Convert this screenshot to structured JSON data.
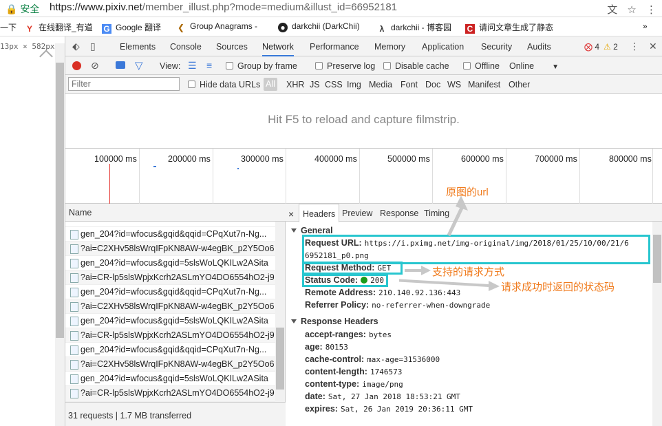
{
  "address_bar": {
    "secure_label": "安全",
    "url_main": "https://www.pixiv.net",
    "url_rest": "/member_illust.php?mode=medium&illust_id=66952181"
  },
  "bookmarks": [
    {
      "icon": "text-icon",
      "label": "一下"
    },
    {
      "icon": "youdao-icon",
      "label": "在线翻译_有道"
    },
    {
      "icon": "translate-icon",
      "label": "Google 翻译"
    },
    {
      "icon": "anagram-icon",
      "label": "Group Anagrams -"
    },
    {
      "icon": "github-icon",
      "label": "darkchii (DarkChii)"
    },
    {
      "icon": "cnblogs-icon",
      "label": "darkchii - 博客园"
    },
    {
      "icon": "csdn-icon",
      "label": "请问文章生成了静态"
    }
  ],
  "page_dims": "13px × 582px",
  "devtools": {
    "tabs": [
      "Elements",
      "Console",
      "Sources",
      "Network",
      "Performance",
      "Memory",
      "Application",
      "Security",
      "Audits"
    ],
    "active_tab": "Network",
    "error_count": "4",
    "warning_count": "2",
    "toolbar": {
      "view_label": "View:",
      "group_by_frame": "Group by frame",
      "preserve_log": "Preserve log",
      "disable_cache": "Disable cache",
      "offline": "Offline",
      "throttle": "Online"
    },
    "filter": {
      "placeholder": "Filter",
      "hide_data_urls": "Hide data URLs",
      "types": [
        "All",
        "XHR",
        "JS",
        "CSS",
        "Img",
        "Media",
        "Font",
        "Doc",
        "WS",
        "Manifest",
        "Other"
      ]
    },
    "filmstrip_message": "Hit F5 to reload and capture filmstrip.",
    "timeline_ticks": [
      "100000 ms",
      "200000 ms",
      "300000 ms",
      "400000 ms",
      "500000 ms",
      "600000 ms",
      "700000 ms",
      "800000 ms"
    ],
    "requests": {
      "column_name": "Name",
      "rows": [
        "gen_204?id=wfocus&gqid&qqid=CPqXut7n-Ng...",
        "?ai=C2XHv58lsWrqIFpKN8AW-w4egBK_p2Y5Oo6",
        "gen_204?id=wfocus&gqid=5slsWoLQKILw2ASita",
        "?ai=CR-lp5slsWpjxKcrh2ASLmYO4DO6554hO2-j9",
        "gen_204?id=wfocus&gqid&qqid=CPqXut7n-Ng...",
        "?ai=C2XHv58lsWrqIFpKN8AW-w4egBK_p2Y5Oo6",
        "gen_204?id=wfocus&gqid=5slsWoLQKILw2ASita",
        "?ai=CR-lp5slsWpjxKcrh2ASLmYO4DO6554hO2-j9",
        "gen_204?id=wfocus&gqid&qqid=CPqXut7n-Ng...",
        "?ai=C2XHv58lsWrqIFpKN8AW-w4egBK_p2Y5Oo6",
        "gen_204?id=wfocus&gqid=5slsWoLQKILw2ASita",
        "?ai=CR-lp5slsWpjxKcrh2ASLmYO4DO6554hO2-j9"
      ],
      "status": "31 requests  |  1.7 MB transferred"
    },
    "details": {
      "tabs": [
        "Headers",
        "Preview",
        "Response",
        "Timing"
      ],
      "general_title": "General",
      "request_url_key": "Request URL:",
      "request_url_line1": "https://i.pximg.net/img-original/img/2018/01/25/10/00/21/6",
      "request_url_line2": "6952181_p0.png",
      "request_method_key": "Request Method:",
      "request_method": "GET",
      "status_code_key": "Status Code:",
      "status_code": "200",
      "remote_address_key": "Remote Address:",
      "remote_address": "210.140.92.136:443",
      "referrer_policy_key": "Referrer Policy:",
      "referrer_policy": "no-referrer-when-downgrade",
      "response_headers_title": "Response Headers",
      "response_headers": [
        {
          "key": "accept-ranges:",
          "value": "bytes"
        },
        {
          "key": "age:",
          "value": "80153"
        },
        {
          "key": "cache-control:",
          "value": "max-age=31536000"
        },
        {
          "key": "content-length:",
          "value": "1746573"
        },
        {
          "key": "content-type:",
          "value": "image/png"
        },
        {
          "key": "date:",
          "value": "Sat, 27 Jan 2018 18:53:21 GMT"
        },
        {
          "key": "expires:",
          "value": "Sat, 26 Jan 2019 20:36:11 GMT"
        }
      ]
    }
  },
  "annotations": {
    "original_url": "原图的url",
    "request_method": "支持的请求方式",
    "status_code": "请求成功时返回的状态码"
  },
  "colors": {
    "annotation_box": "#28c6cf",
    "annotation_text": "#f07b1d",
    "active_tab_underline": "#3879d9",
    "status_green": "#1a9b1a"
  }
}
